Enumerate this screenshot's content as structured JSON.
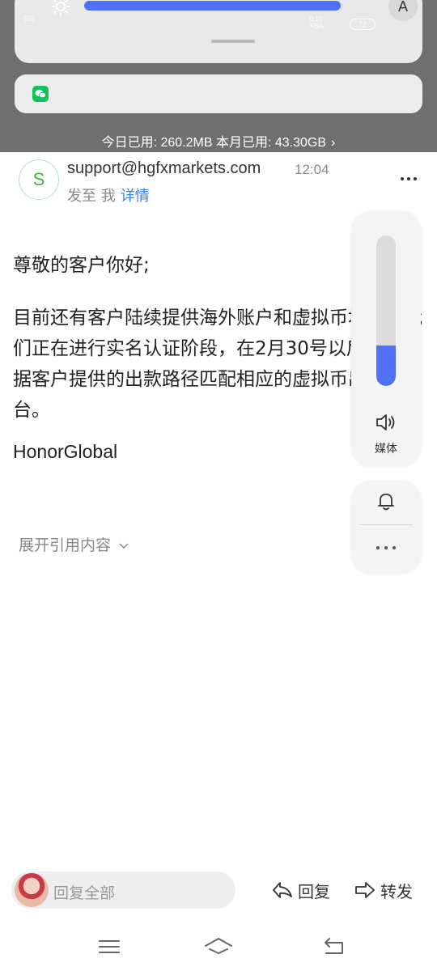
{
  "status_bar": {
    "left_text": "5G",
    "speed": "0.10",
    "speed_unit": "KB/s",
    "battery": "72"
  },
  "quick_settings": {
    "brightness_level": 0.99,
    "auto_label": "A",
    "brightness_icon": "sun-icon",
    "colors": {
      "accent": "#4f6ff5"
    }
  },
  "notification": {
    "app_icon": "wechat-icon",
    "data_usage": "今日已用: 260.2MB 本月已用: 43.30GB"
  },
  "email": {
    "avatar_letter": "S",
    "sender": "support@hgfxmarkets.com",
    "time": "12:04",
    "to_prefix": "发至 我",
    "details_link": "详情",
    "greeting": "尊敬的客户你好;",
    "paragraph": "目前还有客户陆续提供海外账户和虚拟币地址，我们正在进行实名认证阶段，在2月30号以后，会依据客户提供的出款路径匹配相应的虚拟币出款平台。",
    "signature": "HonorGlobal",
    "expand_quote": "展开引用内容"
  },
  "volume_panel": {
    "level": 0.27,
    "label": "媒体"
  },
  "reply_bar": {
    "placeholder": "回复全部",
    "reply_label": "回复",
    "forward_label": "转发"
  }
}
